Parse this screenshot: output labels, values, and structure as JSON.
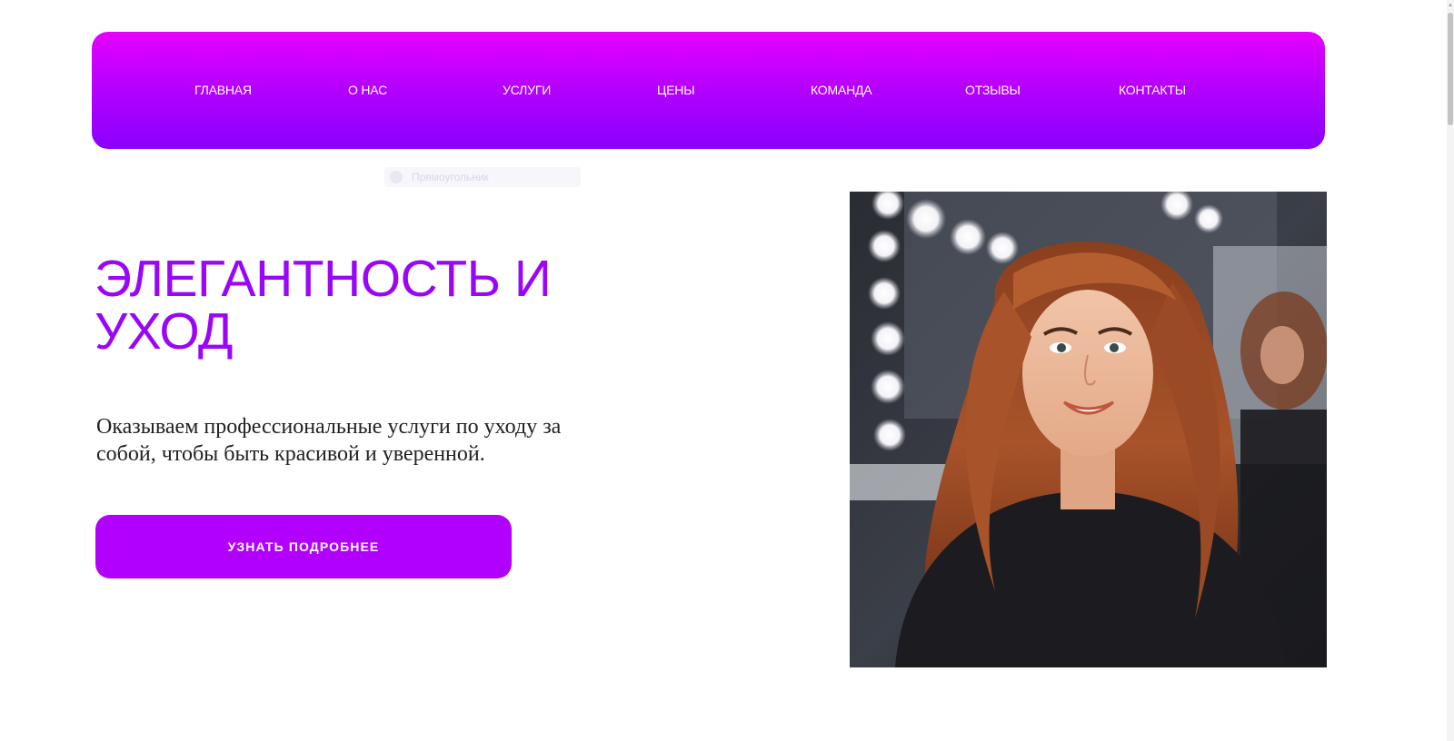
{
  "nav": {
    "items": [
      {
        "label": "ГЛАВНАЯ"
      },
      {
        "label": "О НАС"
      },
      {
        "label": "УСЛУГИ"
      },
      {
        "label": "ЦЕНЫ"
      },
      {
        "label": "КОМАНДА"
      },
      {
        "label": "ОТЗЫВЫ"
      },
      {
        "label": "КОНТАКТЫ"
      }
    ]
  },
  "ghost_label": "Прямоугольник",
  "hero": {
    "title_line1": "ЭЛЕГАНТНОСТЬ И",
    "title_line2": "УХОД",
    "text_line1": "Оказываем профессиональные услуги по уходу за",
    "text_line2": "собой, чтобы быть красивой и уверенной.",
    "cta_label": "УЗНАТЬ ПОДРОБНЕЕ"
  },
  "colors": {
    "accent": "#b200ff",
    "title": "#9a06f7",
    "nav_gradient_top": "#e600ff",
    "nav_gradient_bottom": "#8a00ff"
  },
  "icons": {
    "hero_image": "woman-portrait-image",
    "scroll_up": "arrow-up-icon"
  }
}
